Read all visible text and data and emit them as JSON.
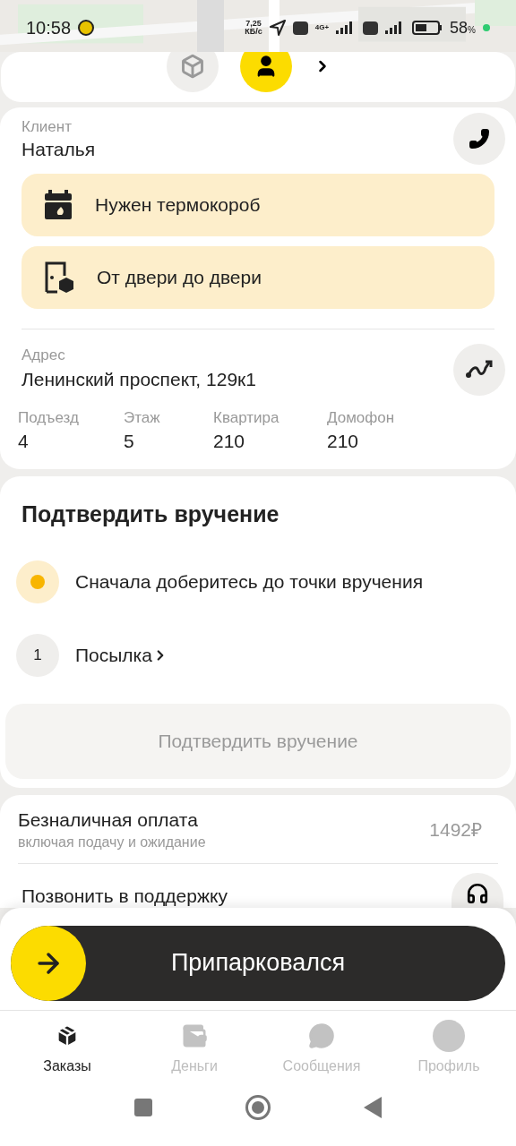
{
  "status_bar": {
    "time": "10:58",
    "speed": "7,25\nКБ/с",
    "network": "4G+",
    "battery": "58",
    "battery_unit": "%"
  },
  "steps": [
    {
      "kind": "parcel",
      "selected": false
    },
    {
      "kind": "client",
      "selected": true
    }
  ],
  "client": {
    "label": "Клиент",
    "name": "Наталья"
  },
  "notes": [
    {
      "kind": "thermobox",
      "text": "Нужен термокороб"
    },
    {
      "kind": "door",
      "text": "От двери до двери"
    }
  ],
  "address": {
    "label": "Адрес",
    "value": "Ленинский проспект, 129к1",
    "details": [
      {
        "label": "Подъезд",
        "value": "4"
      },
      {
        "label": "Этаж",
        "value": "5"
      },
      {
        "label": "Квартира",
        "value": "210"
      },
      {
        "label": "Домофон",
        "value": "210"
      }
    ]
  },
  "confirm": {
    "title": "Подтвердить вручение",
    "items": [
      {
        "kind": "status",
        "text": "Сначала доберитесь до точки вручения"
      },
      {
        "kind": "parcel",
        "count": "1",
        "text": "Посылка"
      }
    ],
    "button": {
      "label": "Подтвердить вручение",
      "disabled": true
    }
  },
  "payment": {
    "title": "Безналичная оплата",
    "subtitle": "включая подачу и ожидание",
    "amount": "1492₽"
  },
  "support": {
    "label": "Позвонить в поддержку"
  },
  "slide_button": {
    "label": "Припарковался"
  },
  "tabs": [
    {
      "kind": "orders",
      "label": "Заказы",
      "selected": true
    },
    {
      "kind": "money",
      "label": "Деньги",
      "selected": false
    },
    {
      "kind": "messages",
      "label": "Сообщения",
      "selected": false
    },
    {
      "kind": "profile",
      "label": "Профиль",
      "selected": false
    }
  ]
}
